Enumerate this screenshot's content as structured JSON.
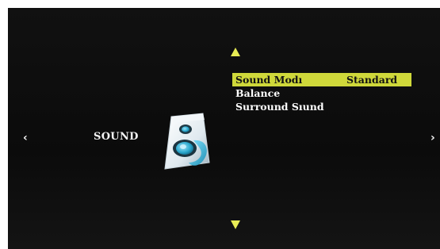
{
  "nav": {
    "left_glyph": "‹",
    "right_glyph": "›"
  },
  "category": {
    "label": "SOUND",
    "icon": "speaker-icon"
  },
  "menu": {
    "items": [
      {
        "label": "Sound Modı",
        "value": "Standard",
        "selected": true
      },
      {
        "label": "Balance",
        "value": "",
        "selected": false
      },
      {
        "label": "Surround Sıund",
        "value": "",
        "selected": false
      }
    ]
  },
  "colors": {
    "highlight": "#cfd83a",
    "arrow": "#e8ec55",
    "background": "#111111",
    "text": "#ffffff"
  }
}
